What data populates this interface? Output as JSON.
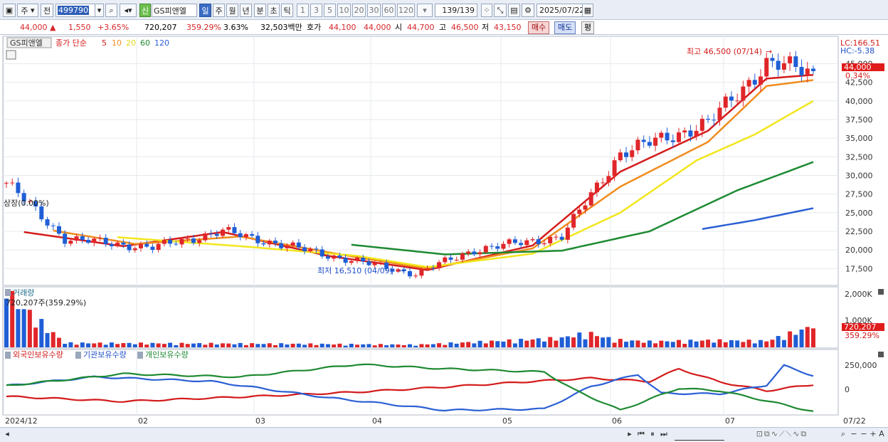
{
  "toolbar": {
    "market_label": "주",
    "prev_label": "전",
    "stock_code": "499790",
    "credit_badge": "신",
    "stock_name": "GS피앤엘",
    "period_buttons": [
      "일",
      "주",
      "월",
      "년",
      "분",
      "초",
      "틱"
    ],
    "active_period": "일",
    "interval_buttons": [
      "1",
      "3",
      "5",
      "10",
      "20",
      "30",
      "60",
      "120"
    ],
    "bar_count": "139",
    "bar_total": "/139",
    "date": "2025/07/22"
  },
  "quote": {
    "price": "44,000",
    "change": "1,550",
    "change_pct": "+3.65%",
    "volume": "720,207",
    "volume_ratio": "359.29%",
    "turnover": "3.63%",
    "amount": "32,503백만",
    "bid_label": "호가",
    "bid": "44,100",
    "ask": "44,000",
    "open_label": "시",
    "open": "44,700",
    "high_label": "고",
    "high": "46,500",
    "low_label": "저",
    "low": "43,150",
    "buy_label": "매수",
    "sell_label": "매도",
    "avg_label": "평"
  },
  "price_panel": {
    "stock_label": "GS피앤엘",
    "ma_title": "종가 단순",
    "ma_periods": [
      "5",
      "10",
      "20",
      "60",
      "120"
    ],
    "ma_colors": [
      "#d41a1a",
      "#f08c1e",
      "#f2e61c",
      "#1e8a32",
      "#2a5fd4"
    ],
    "lc_label": "LC:166.51",
    "hc_label": "HC:-5.38",
    "current_price_tag": "44,000",
    "current_pct_tag": "0.34%",
    "high_annotation": "최고 46,500 (07/14)",
    "low_annotation": "최저 16,510 (04/09)",
    "listing_annotation": "상장(0.00%)",
    "y_ticks": [
      "45,000",
      "42,500",
      "40,000",
      "37,500",
      "35,000",
      "32,500",
      "30,000",
      "27,500",
      "25,000",
      "22,500",
      "20,000",
      "17,500"
    ]
  },
  "volume_panel": {
    "title": "거래량",
    "last_label": "720,207주(359.29%)",
    "y_ticks": [
      "2,000K",
      "1,000K"
    ],
    "tag_value": "720,207",
    "tag_pct": "359.29%"
  },
  "holdings_panel": {
    "series_labels": [
      "외국인보유수량",
      "기관보유수량",
      "개인보유수량"
    ],
    "series_colors": [
      "#d41a1a",
      "#2a5fd4",
      "#1e8a32"
    ],
    "y_ticks": [
      "250,000",
      "0"
    ]
  },
  "x_axis": {
    "labels": [
      "2024/12",
      "02",
      "03",
      "04",
      "05",
      "06",
      "07"
    ],
    "right_label": "07/22"
  },
  "chart_data": {
    "type": "candlestick",
    "ylim": [
      15000,
      47500
    ],
    "bars": 139,
    "close_samples": [
      {
        "bar": 0,
        "close": 29000
      },
      {
        "bar": 10,
        "close": 21500
      },
      {
        "bar": 25,
        "close": 20300
      },
      {
        "bar": 37,
        "close": 22500
      },
      {
        "bar": 55,
        "close": 19300
      },
      {
        "bar": 70,
        "close": 16800
      },
      {
        "bar": 80,
        "close": 20000
      },
      {
        "bar": 95,
        "close": 21800
      },
      {
        "bar": 105,
        "close": 33000
      },
      {
        "bar": 120,
        "close": 37000
      },
      {
        "bar": 130,
        "close": 45000
      },
      {
        "bar": 138,
        "close": 44000
      }
    ],
    "ma5_samples": [
      [
        3,
        22400
      ],
      [
        20,
        20500
      ],
      [
        37,
        22400
      ],
      [
        55,
        19200
      ],
      [
        72,
        17300
      ],
      [
        90,
        20600
      ],
      [
        105,
        30500
      ],
      [
        120,
        36000
      ],
      [
        130,
        43000
      ],
      [
        138,
        43500
      ]
    ],
    "ma10_samples": [
      [
        8,
        22600
      ],
      [
        22,
        20800
      ],
      [
        40,
        21800
      ],
      [
        60,
        19000
      ],
      [
        72,
        17500
      ],
      [
        90,
        20200
      ],
      [
        105,
        28500
      ],
      [
        120,
        34500
      ],
      [
        130,
        42000
      ],
      [
        138,
        42800
      ]
    ],
    "ma20_samples": [
      [
        19,
        21700
      ],
      [
        40,
        20500
      ],
      [
        60,
        19200
      ],
      [
        72,
        17700
      ],
      [
        90,
        19500
      ],
      [
        105,
        25000
      ],
      [
        118,
        32000
      ],
      [
        128,
        35500
      ],
      [
        138,
        40000
      ]
    ],
    "ma60_samples": [
      [
        59,
        20700
      ],
      [
        75,
        19400
      ],
      [
        95,
        19900
      ],
      [
        110,
        22500
      ],
      [
        125,
        28000
      ],
      [
        138,
        31800
      ]
    ],
    "ma120_samples": [
      [
        119,
        22800
      ],
      [
        128,
        24000
      ],
      [
        138,
        25600
      ]
    ],
    "volume_k_samples": [
      [
        0,
        1850
      ],
      [
        10,
        150
      ],
      [
        50,
        120
      ],
      [
        70,
        90
      ],
      [
        95,
        320
      ],
      [
        97,
        420
      ],
      [
        100,
        470
      ],
      [
        104,
        260
      ],
      [
        110,
        200
      ],
      [
        120,
        240
      ],
      [
        130,
        220
      ],
      [
        138,
        720
      ]
    ],
    "foreign_holdings_samples": [
      [
        0,
        -130000
      ],
      [
        20,
        -210000
      ],
      [
        45,
        -120000
      ],
      [
        60,
        -60000
      ],
      [
        75,
        20000
      ],
      [
        90,
        110000
      ],
      [
        100,
        160000
      ],
      [
        110,
        110000
      ],
      [
        115,
        310000
      ],
      [
        122,
        100000
      ],
      [
        130,
        -40000
      ],
      [
        138,
        60000
      ]
    ],
    "institution_holdings_samples": [
      [
        0,
        40000
      ],
      [
        15,
        180000
      ],
      [
        35,
        110000
      ],
      [
        55,
        -150000
      ],
      [
        75,
        -350000
      ],
      [
        92,
        -330000
      ],
      [
        100,
        30000
      ],
      [
        108,
        220000
      ],
      [
        112,
        -80000
      ],
      [
        122,
        -90000
      ],
      [
        130,
        50000
      ],
      [
        133,
        360000
      ],
      [
        138,
        200000
      ]
    ],
    "individual_holdings_samples": [
      [
        0,
        40000
      ],
      [
        20,
        230000
      ],
      [
        40,
        180000
      ],
      [
        60,
        380000
      ],
      [
        75,
        310000
      ],
      [
        92,
        260000
      ],
      [
        97,
        -20000
      ],
      [
        105,
        -350000
      ],
      [
        115,
        0
      ],
      [
        122,
        -40000
      ],
      [
        130,
        -200000
      ],
      [
        138,
        -370000
      ]
    ]
  }
}
